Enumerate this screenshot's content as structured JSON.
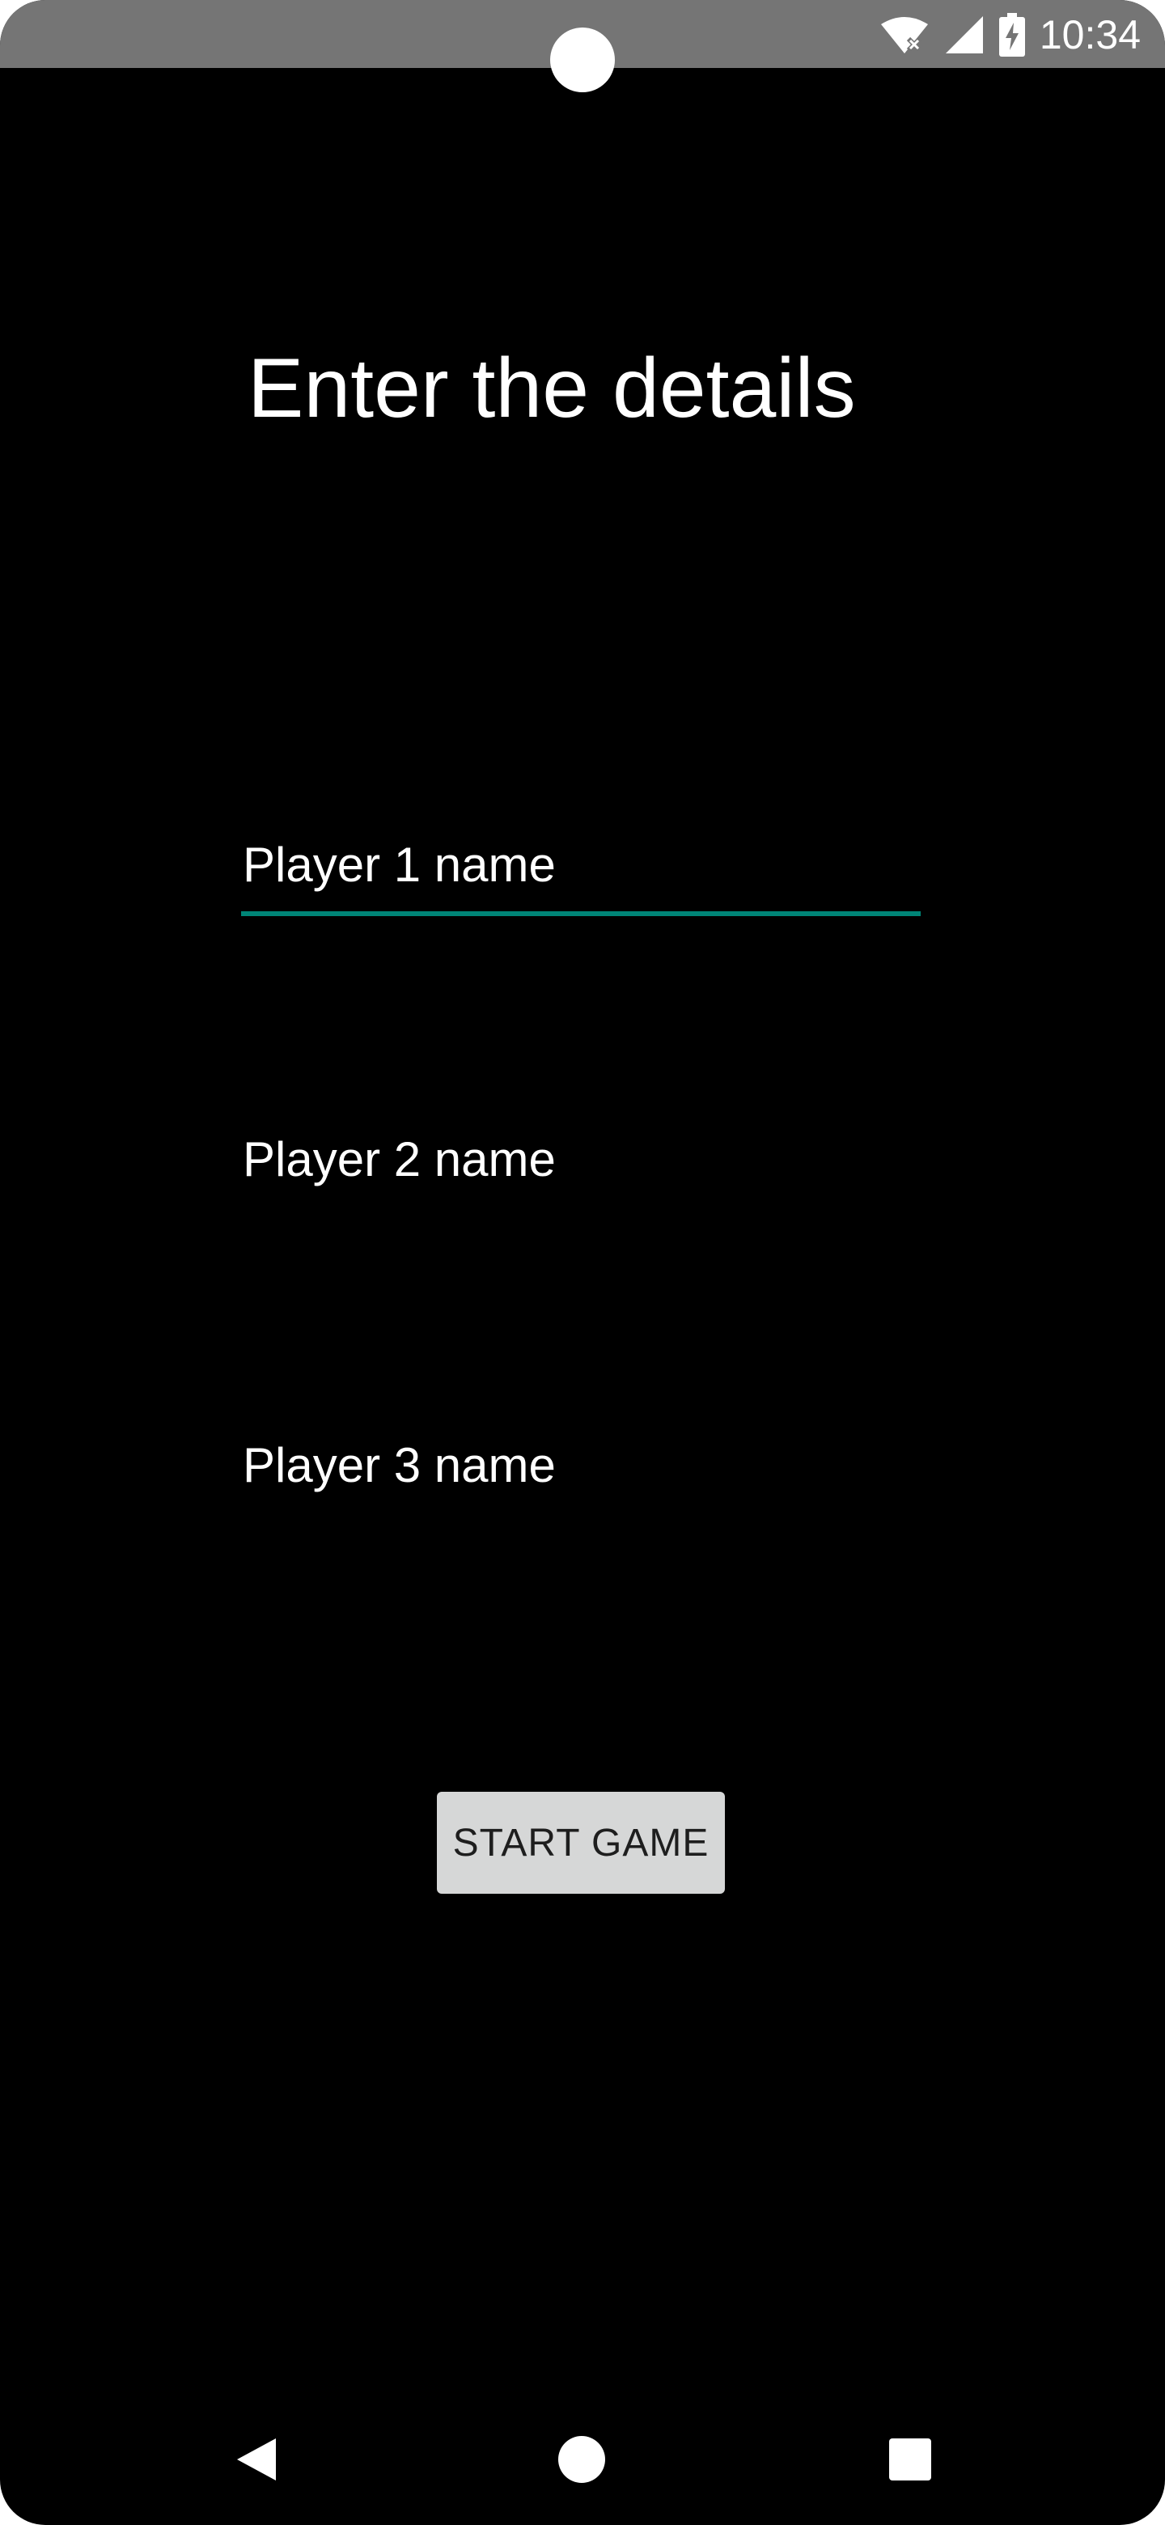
{
  "status_bar": {
    "time": "10:34",
    "icons": [
      "wifi-no-internet-icon",
      "cell-signal-icon",
      "battery-charging-icon"
    ],
    "background_color": "#757575"
  },
  "screen": {
    "title": "Enter the details",
    "background_color": "#000000",
    "accent_color": "#008577"
  },
  "form": {
    "player1": {
      "placeholder": "Player 1 name",
      "value": ""
    },
    "player2": {
      "placeholder": "Player 2 name",
      "value": ""
    },
    "player3": {
      "placeholder": "Player 3 name",
      "value": ""
    },
    "start_button_label": "START GAME"
  },
  "nav_bar": {
    "icons": [
      "back-icon",
      "home-icon",
      "recents-icon"
    ]
  }
}
